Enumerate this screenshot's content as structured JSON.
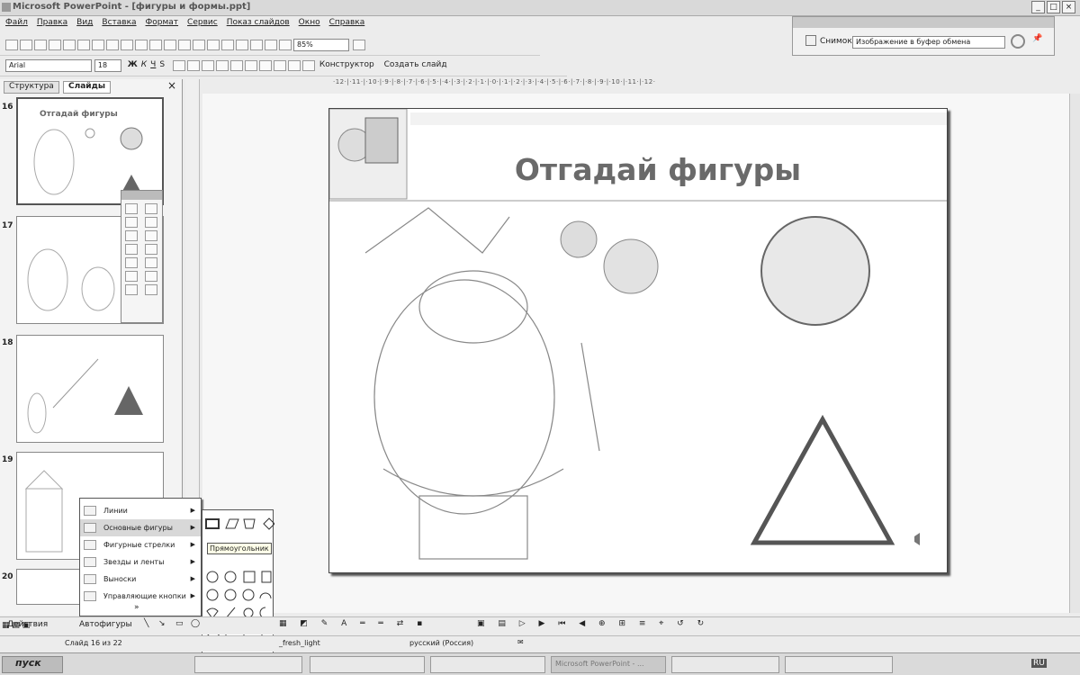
{
  "window": {
    "title": "Microsoft PowerPoint - [фигуры и формы.ppt]"
  },
  "menu": [
    "Файл",
    "Правка",
    "Вид",
    "Вставка",
    "Формат",
    "Сервис",
    "Показ слайдов",
    "Окно",
    "Справка"
  ],
  "toolbar": {
    "zoom": "85%",
    "font": "Arial",
    "size": "18",
    "bold": "Ж",
    "italic": "К",
    "underline": "Ч",
    "shadow": "S",
    "designer": "Конструктор",
    "new_slide": "Создать слайд"
  },
  "snapshot": {
    "label": "Снимок",
    "mode": "Изображение в буфер обмена"
  },
  "panel": {
    "tab_structure": "Структура",
    "tab_slides": "Слайды",
    "close": "×",
    "thumbs": [
      {
        "num": "16",
        "title": "Отгадай фигуры"
      },
      {
        "num": "17"
      },
      {
        "num": "18"
      },
      {
        "num": "19"
      },
      {
        "num": "20"
      }
    ]
  },
  "ruler": "·12·|·11·|·10·|·9·|·8·|·7·|·6·|·5·|·4·|·3·|·2·|·1·|·0·|·1·|·2·|·3·|·4·|·5·|·6·|·7·|·8·|·9·|·10·|·11·|·12·",
  "slide": {
    "title": "Отгадай фигуры"
  },
  "autoshapes_menu": {
    "items": [
      "Линии",
      "Основные фигуры",
      "Фигурные стрелки",
      "Звезды и ленты",
      "Выноски",
      "Управляющие кнопки"
    ],
    "more": "»",
    "tooltip": "Прямоугольник"
  },
  "drawbar": {
    "actions": "Действия",
    "autoshapes": "Автофигуры"
  },
  "status": {
    "slide": "Слайд 16 из 22",
    "design": "_fresh_light",
    "lang": "русский (Россия)"
  },
  "taskbar": {
    "start": "пуск",
    "lang": "RU",
    "items": [
      "Microsoft PowerPoint - ..."
    ]
  }
}
